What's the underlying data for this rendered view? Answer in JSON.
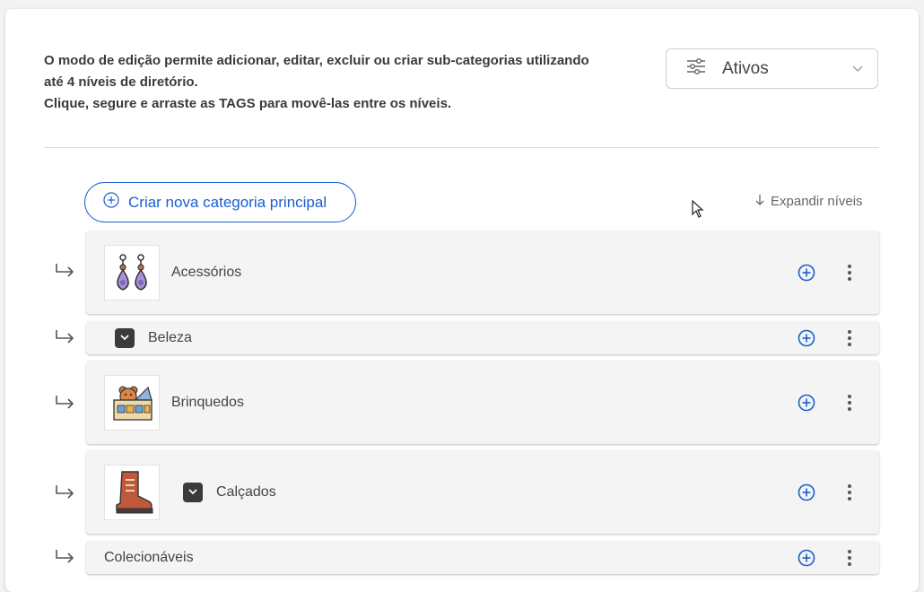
{
  "intro": {
    "line1": "O modo de edição permite adicionar, editar, excluir ou criar sub-categorias utilizando",
    "line2": "até 4 níveis de diretório.",
    "line3": "Clique, segure e arraste as TAGS para movê-las entre os níveis."
  },
  "filter": {
    "icon": "sliders-icon",
    "label": "Ativos"
  },
  "actions": {
    "create_label": "Criar nova categoria principal",
    "expand_label": "Expandir níveis"
  },
  "categories": [
    {
      "label": "Acessórios",
      "thumb": "earrings-image",
      "expander": false
    },
    {
      "label": "Beleza",
      "thumb": null,
      "expander": true
    },
    {
      "label": "Brinquedos",
      "thumb": "toy-box-image",
      "expander": false
    },
    {
      "label": "Calçados",
      "thumb": "boot-image",
      "expander": true
    },
    {
      "label": "Colecionáveis",
      "thumb": null,
      "expander": false
    }
  ],
  "colors": {
    "accent": "#1a5fd0",
    "row_bg": "#f4f4f4"
  }
}
